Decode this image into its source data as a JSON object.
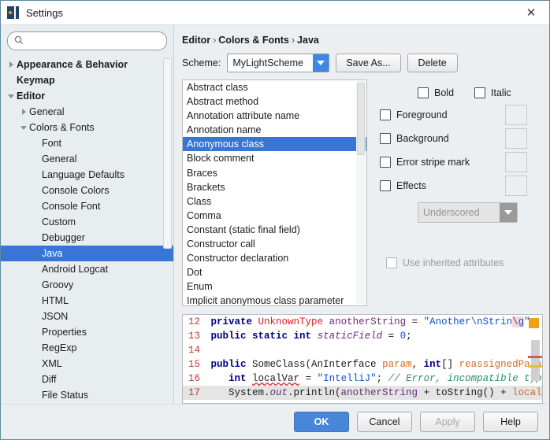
{
  "window": {
    "title": "Settings",
    "app_icon": "intellij-idea-icon",
    "close_label": "✕"
  },
  "sidebar": {
    "search": {
      "value": "",
      "placeholder": "",
      "icon": "search-icon"
    },
    "items": [
      {
        "label": "Appearance & Behavior",
        "indent": 0,
        "twisty": "collapsed",
        "bold": true,
        "selected": false
      },
      {
        "label": "Keymap",
        "indent": 0,
        "twisty": "none",
        "bold": true,
        "selected": false
      },
      {
        "label": "Editor",
        "indent": 0,
        "twisty": "expanded",
        "bold": true,
        "selected": false
      },
      {
        "label": "General",
        "indent": 1,
        "twisty": "collapsed",
        "bold": false,
        "selected": false
      },
      {
        "label": "Colors & Fonts",
        "indent": 1,
        "twisty": "expanded",
        "bold": false,
        "selected": false
      },
      {
        "label": "Font",
        "indent": 2,
        "twisty": "none",
        "bold": false,
        "selected": false
      },
      {
        "label": "General",
        "indent": 2,
        "twisty": "none",
        "bold": false,
        "selected": false
      },
      {
        "label": "Language Defaults",
        "indent": 2,
        "twisty": "none",
        "bold": false,
        "selected": false
      },
      {
        "label": "Console Colors",
        "indent": 2,
        "twisty": "none",
        "bold": false,
        "selected": false
      },
      {
        "label": "Console Font",
        "indent": 2,
        "twisty": "none",
        "bold": false,
        "selected": false
      },
      {
        "label": "Custom",
        "indent": 2,
        "twisty": "none",
        "bold": false,
        "selected": false
      },
      {
        "label": "Debugger",
        "indent": 2,
        "twisty": "none",
        "bold": false,
        "selected": false
      },
      {
        "label": "Java",
        "indent": 2,
        "twisty": "none",
        "bold": false,
        "selected": true
      },
      {
        "label": "Android Logcat",
        "indent": 2,
        "twisty": "none",
        "bold": false,
        "selected": false
      },
      {
        "label": "Groovy",
        "indent": 2,
        "twisty": "none",
        "bold": false,
        "selected": false
      },
      {
        "label": "HTML",
        "indent": 2,
        "twisty": "none",
        "bold": false,
        "selected": false
      },
      {
        "label": "JSON",
        "indent": 2,
        "twisty": "none",
        "bold": false,
        "selected": false
      },
      {
        "label": "Properties",
        "indent": 2,
        "twisty": "none",
        "bold": false,
        "selected": false
      },
      {
        "label": "RegExp",
        "indent": 2,
        "twisty": "none",
        "bold": false,
        "selected": false
      },
      {
        "label": "XML",
        "indent": 2,
        "twisty": "none",
        "bold": false,
        "selected": false
      },
      {
        "label": "Diff",
        "indent": 2,
        "twisty": "none",
        "bold": false,
        "selected": false
      },
      {
        "label": "File Status",
        "indent": 2,
        "twisty": "none",
        "bold": false,
        "selected": false
      }
    ]
  },
  "breadcrumb": {
    "parts": [
      "Editor",
      "Colors & Fonts",
      "Java"
    ],
    "separator": "›"
  },
  "scheme": {
    "label": "Scheme:",
    "value": "MyLightScheme",
    "save_as_label": "Save As...",
    "delete_label": "Delete"
  },
  "color_list": {
    "selected": "Anonymous class",
    "items": [
      "Abstract class",
      "Abstract method",
      "Annotation attribute name",
      "Annotation name",
      "Anonymous class",
      "Block comment",
      "Braces",
      "Brackets",
      "Class",
      "Comma",
      "Constant (static final field)",
      "Constructor call",
      "Constructor declaration",
      "Dot",
      "Enum",
      "Implicit anonymous class parameter"
    ]
  },
  "attributes": {
    "bold": {
      "label": "Bold",
      "checked": false
    },
    "italic": {
      "label": "Italic",
      "checked": false
    },
    "rows": [
      {
        "label": "Foreground",
        "checked": false,
        "swatch": "#eceff1"
      },
      {
        "label": "Background",
        "checked": false,
        "swatch": "#eceff1"
      },
      {
        "label": "Error stripe mark",
        "checked": false,
        "swatch": "#eceff1"
      },
      {
        "label": "Effects",
        "checked": false,
        "swatch": "#eceff1"
      }
    ],
    "effect_type": "Underscored",
    "use_inherited": {
      "label": "Use inherited attributes",
      "checked": false,
      "disabled": true
    }
  },
  "preview": {
    "lines": [
      {
        "number": "12",
        "current": false,
        "tokens": [
          {
            "t": " ",
            "c": "plain"
          },
          {
            "t": "private",
            "c": "kw"
          },
          {
            "t": " ",
            "c": "plain"
          },
          {
            "t": "UnknownType",
            "c": "err"
          },
          {
            "t": " ",
            "c": "plain"
          },
          {
            "t": "anotherString",
            "c": "fld"
          },
          {
            "t": " = ",
            "c": "plain"
          },
          {
            "t": "\"Another\\nStrin",
            "c": "str"
          },
          {
            "t": "\\g",
            "c": "esc"
          },
          {
            "t": "\";",
            "c": "str"
          }
        ]
      },
      {
        "number": "13",
        "current": false,
        "tokens": [
          {
            "t": " ",
            "c": "plain"
          },
          {
            "t": "public static int",
            "c": "kw"
          },
          {
            "t": " ",
            "c": "plain"
          },
          {
            "t": "staticField",
            "c": "sfld"
          },
          {
            "t": " = ",
            "c": "plain"
          },
          {
            "t": "0",
            "c": "num"
          },
          {
            "t": ";",
            "c": "plain"
          }
        ]
      },
      {
        "number": "14",
        "current": false,
        "tokens": []
      },
      {
        "number": "15",
        "current": false,
        "tokens": [
          {
            "t": " ",
            "c": "plain"
          },
          {
            "t": "public",
            "c": "kw"
          },
          {
            "t": " SomeClass(AnInterface ",
            "c": "plain"
          },
          {
            "t": "param",
            "c": "par"
          },
          {
            "t": ", ",
            "c": "plain"
          },
          {
            "t": "int",
            "c": "kw"
          },
          {
            "t": "[] ",
            "c": "plain"
          },
          {
            "t": "reassignedParam",
            "c": "par"
          }
        ]
      },
      {
        "number": "16",
        "current": false,
        "tokens": [
          {
            "t": "    ",
            "c": "plain"
          },
          {
            "t": "int",
            "c": "kw"
          },
          {
            "t": " ",
            "c": "plain"
          },
          {
            "t": "localVar",
            "c": "typo"
          },
          {
            "t": " = ",
            "c": "plain"
          },
          {
            "t": "\"IntelliJ\"",
            "c": "str"
          },
          {
            "t": "; ",
            "c": "plain"
          },
          {
            "t": "// Error, incompatible types",
            "c": "cmt"
          }
        ]
      },
      {
        "number": "17",
        "current": true,
        "tokens": [
          {
            "t": "    System.",
            "c": "plain"
          },
          {
            "t": "out",
            "c": "sfld"
          },
          {
            "t": ".println(",
            "c": "plain"
          },
          {
            "t": "anotherString",
            "c": "fld"
          },
          {
            "t": " + toString() + ",
            "c": "plain"
          },
          {
            "t": "localVa",
            "c": "par"
          }
        ]
      }
    ],
    "stripe_mark": "error-stripe-orange"
  },
  "footer": {
    "ok": "OK",
    "cancel": "Cancel",
    "apply": "Apply",
    "help": "Help"
  },
  "colors": {
    "accent": "#3875d7",
    "primary_button": "#4a86d8",
    "selection": "#3875d7",
    "sidebar_bg": "#e8edf0",
    "panel_bg": "#eceff1"
  }
}
